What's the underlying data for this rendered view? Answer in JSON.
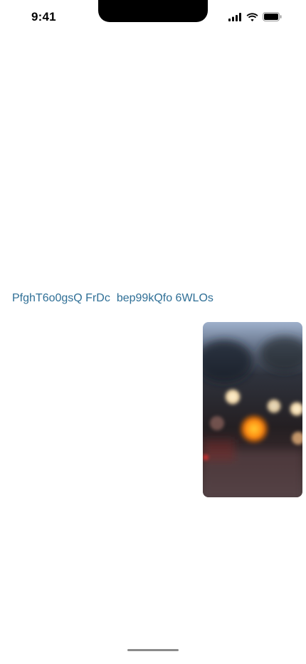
{
  "status_bar": {
    "time": "9:41",
    "icons": [
      "cellular-signal-icon",
      "wifi-icon",
      "battery-icon"
    ]
  },
  "content": {
    "link_primary": "PfghT6o0gsQ FrDc",
    "link_secondary": "bep99kQfo 6WLOs",
    "link_color": "#2f6f96"
  },
  "photo": {
    "description_name": "blurred-bokeh-photo"
  }
}
